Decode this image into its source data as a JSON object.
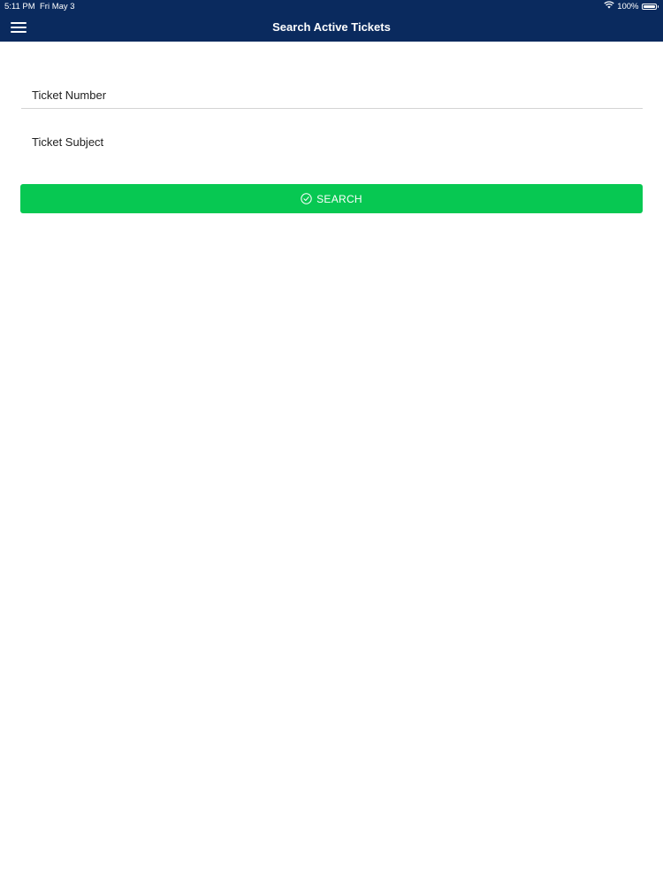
{
  "status_bar": {
    "time": "5:11 PM",
    "date": "Fri May 3",
    "battery": "100%",
    "wifi_icon": "wifi-icon",
    "battery_icon": "battery-icon"
  },
  "nav": {
    "title": "Search Active Tickets",
    "menu_icon": "hamburger-menu-icon"
  },
  "form": {
    "ticket_number_placeholder": "Ticket Number",
    "ticket_number_value": "",
    "ticket_subject_placeholder": "Ticket Subject",
    "ticket_subject_value": ""
  },
  "search_button": {
    "label": "SEARCH",
    "icon": "check-circle-icon"
  },
  "colors": {
    "nav_background": "#0a2a5e",
    "button_green": "#07c852",
    "text_dark": "#222222",
    "divider": "#d4d4d4"
  }
}
